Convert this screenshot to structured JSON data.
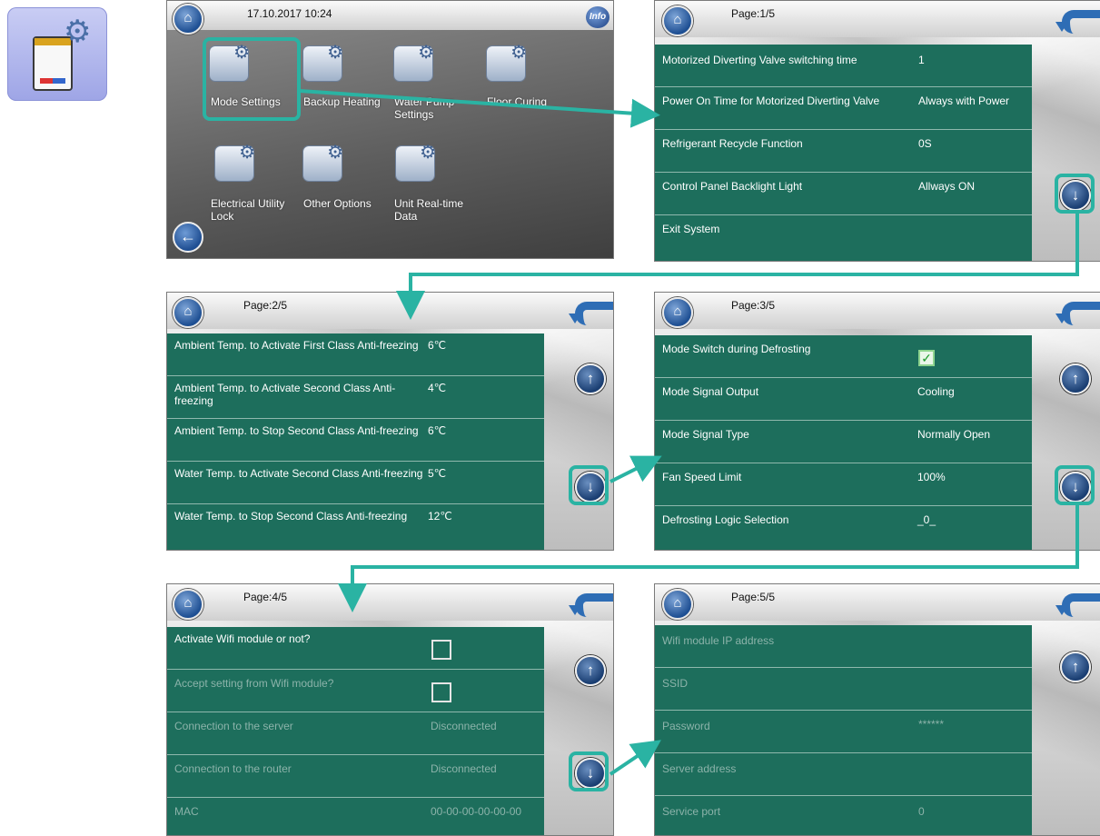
{
  "main_menu": {
    "datetime": "17.10.2017 10:24",
    "info": "Info",
    "items": [
      {
        "label": "Mode Settings",
        "icon": "mode-settings-icon"
      },
      {
        "label": "Backup Heating",
        "icon": "backup-heating-icon"
      },
      {
        "label": "Water Pump Settings",
        "icon": "water-pump-icon"
      },
      {
        "label": "Floor Curing",
        "icon": "floor-curing-icon"
      },
      {
        "label": "Electrical Utility Lock",
        "icon": "electrical-lock-icon"
      },
      {
        "label": "Other Options",
        "icon": "other-options-icon"
      },
      {
        "label": "Unit Real-time Data",
        "icon": "realtime-data-icon"
      }
    ]
  },
  "page1": {
    "title": "Page:1/5",
    "rows": [
      {
        "label": "Motorized Diverting Valve switching time",
        "value": "1"
      },
      {
        "label": "Power On Time for Motorized Diverting Valve",
        "value": "Always with Power"
      },
      {
        "label": "Refrigerant Recycle Function",
        "value": "0S"
      },
      {
        "label": "Control Panel Backlight Light",
        "value": "Allways ON"
      },
      {
        "label": "Exit System",
        "value": ""
      }
    ]
  },
  "page2": {
    "title": "Page:2/5",
    "rows": [
      {
        "label": "Ambient Temp. to Activate First Class Anti-freezing",
        "value": "6℃"
      },
      {
        "label": "Ambient Temp. to Activate Second Class Anti-freezing",
        "value": "4℃"
      },
      {
        "label": "Ambient Temp. to Stop Second Class Anti-freezing",
        "value": "6℃"
      },
      {
        "label": "Water Temp. to Activate Second Class Anti-freezing",
        "value": "5℃"
      },
      {
        "label": "Water Temp. to Stop Second Class Anti-freezing",
        "value": "12℃"
      }
    ]
  },
  "page3": {
    "title": "Page:3/5",
    "rows": [
      {
        "label": "Mode Switch during Defrosting",
        "value": "",
        "checked": true
      },
      {
        "label": "Mode Signal Output",
        "value": "Cooling"
      },
      {
        "label": "Mode Signal Type",
        "value": "Normally Open"
      },
      {
        "label": "Fan Speed Limit",
        "value": "100%"
      },
      {
        "label": "Defrosting Logic Selection",
        "value": "_0_"
      }
    ]
  },
  "page4": {
    "title": "Page:4/5",
    "rows": [
      {
        "label": "Activate Wifi module or not?",
        "value": "",
        "checked": false
      },
      {
        "label": "Accept setting from Wifi module?",
        "value": "",
        "checked": false
      },
      {
        "label": "Connection to the server",
        "value": "Disconnected"
      },
      {
        "label": "Connection to the router",
        "value": "Disconnected"
      },
      {
        "label": "MAC",
        "value": "00-00-00-00-00-00"
      }
    ]
  },
  "page5": {
    "title": "Page:5/5",
    "rows": [
      {
        "label": "Wifi module IP address",
        "value": ""
      },
      {
        "label": "SSID",
        "value": ""
      },
      {
        "label": "Password",
        "value": "******"
      },
      {
        "label": "Server address",
        "value": ""
      },
      {
        "label": "Service port",
        "value": "0"
      }
    ]
  },
  "colors": {
    "panel": "#1d6e5c",
    "highlight": "#2ab3a3",
    "button": "#1f4e92"
  }
}
